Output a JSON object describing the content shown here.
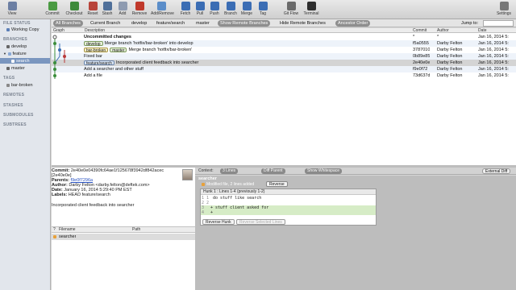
{
  "toolbar": {
    "buttons": [
      {
        "label": "View",
        "icon": "view-icon",
        "color": "#6c7fa3"
      },
      {
        "label": "Commit",
        "icon": "commit-icon",
        "color": "#4a9a42"
      },
      {
        "label": "Checkout",
        "icon": "checkout-icon",
        "color": "#3d8a3a"
      },
      {
        "label": "Reset",
        "icon": "reset-icon",
        "color": "#b8433a"
      },
      {
        "label": "Stash",
        "icon": "stash-icon",
        "color": "#4f6f99"
      },
      {
        "label": "Add",
        "icon": "add-icon",
        "color": "#8e9bb0"
      },
      {
        "label": "Remove",
        "icon": "remove-icon",
        "color": "#c0392b"
      },
      {
        "label": "Add/Remove",
        "icon": "add-remove-icon",
        "color": "#5b8dc9"
      },
      {
        "label": "Fetch",
        "icon": "fetch-icon",
        "color": "#3b6db4"
      },
      {
        "label": "Pull",
        "icon": "pull-icon",
        "color": "#3b6db4"
      },
      {
        "label": "Push",
        "icon": "push-icon",
        "color": "#3b6db4"
      },
      {
        "label": "Branch",
        "icon": "branch-icon",
        "color": "#3b6db4"
      },
      {
        "label": "Merge",
        "icon": "merge-icon",
        "color": "#3b6db4"
      },
      {
        "label": "Tag",
        "icon": "tag-icon",
        "color": "#3b6db4"
      },
      {
        "label": "Git Flow",
        "icon": "git-flow-icon",
        "color": "#6a6a6a"
      },
      {
        "label": "Terminal",
        "icon": "terminal-icon",
        "color": "#2d2d2d"
      },
      {
        "label": "Settings",
        "icon": "settings-icon",
        "color": "#777777"
      }
    ]
  },
  "branchbar": {
    "all_branches": "All Branches",
    "current_branch": "Current Branch",
    "develop": "develop",
    "feature_search": "feature/search",
    "master": "master",
    "show_remote": "Show Remote Branches",
    "hide_remote": "Hide Remote Branches",
    "order": "Ancestor Order",
    "jump_to": "Jump to:"
  },
  "sidebar": {
    "file_status": "FILE STATUS",
    "working_copy": "Working Copy",
    "branches": "BRANCHES",
    "develop": "develop",
    "feature": "feature",
    "search": "search",
    "master": "master",
    "tags": "TAGS",
    "bar_broken": "bar-broken",
    "remotes": "REMOTES",
    "stashes": "STASHES",
    "submodules": "SUBMODULES",
    "subtrees": "SUBTREES"
  },
  "table": {
    "headers": {
      "graph": "Graph",
      "description": "Description",
      "commit": "Commit",
      "author": "Author",
      "date": "Date"
    },
    "rows": [
      {
        "desc": "Uncommitted changes",
        "tags": [],
        "commit": "*",
        "author": "*",
        "date": "Jan 16, 2014 5:"
      },
      {
        "desc": "Merge branch 'hotfix/bar-broken' into develop",
        "tags": [
          {
            "text": "develop",
            "style": "green"
          }
        ],
        "commit": "f5a0555",
        "author": "Darby Felton",
        "date": "Jan 16, 2014 5:"
      },
      {
        "desc": "Merge branch 'hotfix/bar-broken'",
        "tags": [
          {
            "text": "bar-broken",
            "style": "yellow"
          },
          {
            "text": "master",
            "style": "green"
          }
        ],
        "commit": "3787010",
        "author": "Darby Felton",
        "date": "Jan 16, 2014 5:"
      },
      {
        "desc": "Fixed bar",
        "tags": [],
        "commit": "0b89e85",
        "author": "Darby Felton",
        "date": "Jan 16, 2014 5:"
      },
      {
        "desc": "Incorporated client feedback into searcher",
        "tags": [
          {
            "text": "feature/search",
            "style": "blue"
          }
        ],
        "commit": "2e40e0e",
        "author": "Darby Felton",
        "date": "Jan 16, 2014 5:"
      },
      {
        "desc": "Add a searcher and other stuff",
        "tags": [],
        "commit": "f9e0f72",
        "author": "Darby Felton",
        "date": "Jan 16, 2014 5:"
      },
      {
        "desc": "Add a file",
        "tags": [],
        "commit": "73d637d",
        "author": "Darby Felton",
        "date": "Jan 16, 2014 5:"
      }
    ]
  },
  "detail": {
    "commit_label": "Commit:",
    "commit_hash_1": "2e40e0e04390fc64ae1f125678f3942df842acec",
    "commit_hash_2": "[2e40e0e]",
    "parents_label": "Parents:",
    "parents": "f9e0f7296a",
    "author_label": "Author:",
    "author": "Darby Felton <darby.felton@deftek.com>",
    "date_label": "Date:",
    "date": "January 16, 2014 5:29:40 PM EST",
    "labels_label": "Labels:",
    "labels": "HEAD feature/search",
    "message": "Incorporated client feedback into searcher"
  },
  "files": {
    "col_status": "?",
    "col_filename": "Filename",
    "col_path": "Path",
    "rows": [
      {
        "name": "searcher",
        "path": ""
      }
    ]
  },
  "diffbar": {
    "context_label": "Context:",
    "context_value": "3 Lines",
    "diff_parent": "Diff Parent",
    "show_whitespace": "Show Whitespace",
    "external_diff": "External Diff"
  },
  "diff": {
    "file": "searcher",
    "summary": "Modified file, 2 lines added",
    "reverse": "Reverse",
    "hunk_title": "Hunk 1 : Lines 1-4 (previously 1-2)",
    "lines": [
      {
        "num": "1 1",
        "text": "  do stuff like search",
        "type": "ctx"
      },
      {
        "num": "2 2",
        "text": "",
        "type": "ctx"
      },
      {
        "num": "  3",
        "text": "+ stuff client asked for",
        "type": "add"
      },
      {
        "num": "  4",
        "text": "+",
        "type": "add"
      }
    ],
    "reverse_hunk": "Reverse Hunk",
    "reverse_selected": "Reverse Selected Lines"
  }
}
